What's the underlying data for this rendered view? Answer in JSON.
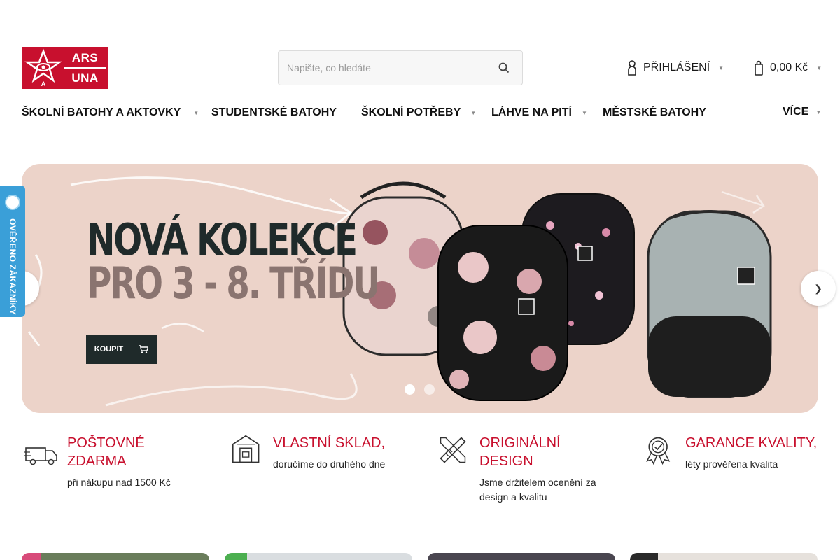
{
  "logo": {
    "line1": "ARS",
    "line2": "UNA",
    "mark": "ARS UNA"
  },
  "search": {
    "placeholder": "Napište, co hledáte",
    "icon": "search-icon"
  },
  "header": {
    "login_label": "PŘIHLÁŠENÍ",
    "cart_total": "0,00 Kč"
  },
  "nav": {
    "items": [
      {
        "label": "ŠKOLNÍ BATOHY A AKTOVKY",
        "has_submenu": true
      },
      {
        "label": "STUDENTSKÉ BATOHY",
        "has_submenu": false
      },
      {
        "label": "ŠKOLNÍ POTŘEBY",
        "has_submenu": true
      },
      {
        "label": "LÁHVE NA PITÍ",
        "has_submenu": true
      },
      {
        "label": "MĚSTSKÉ BATOHY",
        "has_submenu": false
      }
    ],
    "more_label": "VÍCE"
  },
  "hero": {
    "title_line1": "NOVÁ KOLEKCE",
    "title_line2": "PRO 3 - 8. TŘÍDU",
    "button_label": "KOUPIT",
    "slide_count": 2,
    "active_slide": 1,
    "colors": {
      "background": "#ecd3c9",
      "dark": "#1f2a2a",
      "muted": "#8a7470"
    }
  },
  "verified_badge": {
    "label": "OVĚŘENO ZÁKAZNÍKY",
    "color": "#3a9fd8"
  },
  "features": [
    {
      "icon": "truck-icon",
      "title": "POŠTOVNÉ ZDARMA",
      "description": "při nákupu nad 1500 Kč"
    },
    {
      "icon": "warehouse-icon",
      "title": "VLASTNÍ SKLAD,",
      "description": "doručíme do druhého dne"
    },
    {
      "icon": "pencil-ruler-icon",
      "title": "ORIGINÁLNÍ DESIGN",
      "description": "Jsme držitelem ocenění za design a kvalitu"
    },
    {
      "icon": "award-icon",
      "title": "GARANCE KVALITY,",
      "description": "léty prověřena kvalita"
    }
  ],
  "colors": {
    "brand": "#c8102e",
    "text": "#111111"
  }
}
